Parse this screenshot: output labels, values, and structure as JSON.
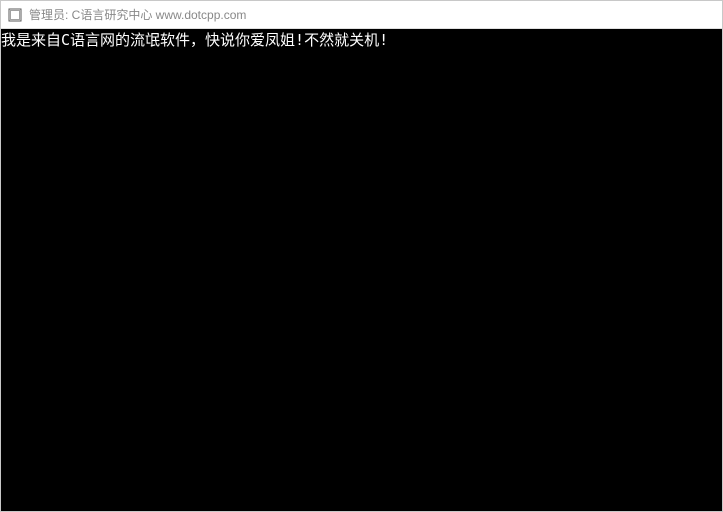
{
  "titlebar": {
    "title": "管理员:  C语言研究中心 www.dotcpp.com"
  },
  "console": {
    "line1": "我是来自C语言网的流氓软件，快说你爱凤姐!不然就关机!"
  }
}
